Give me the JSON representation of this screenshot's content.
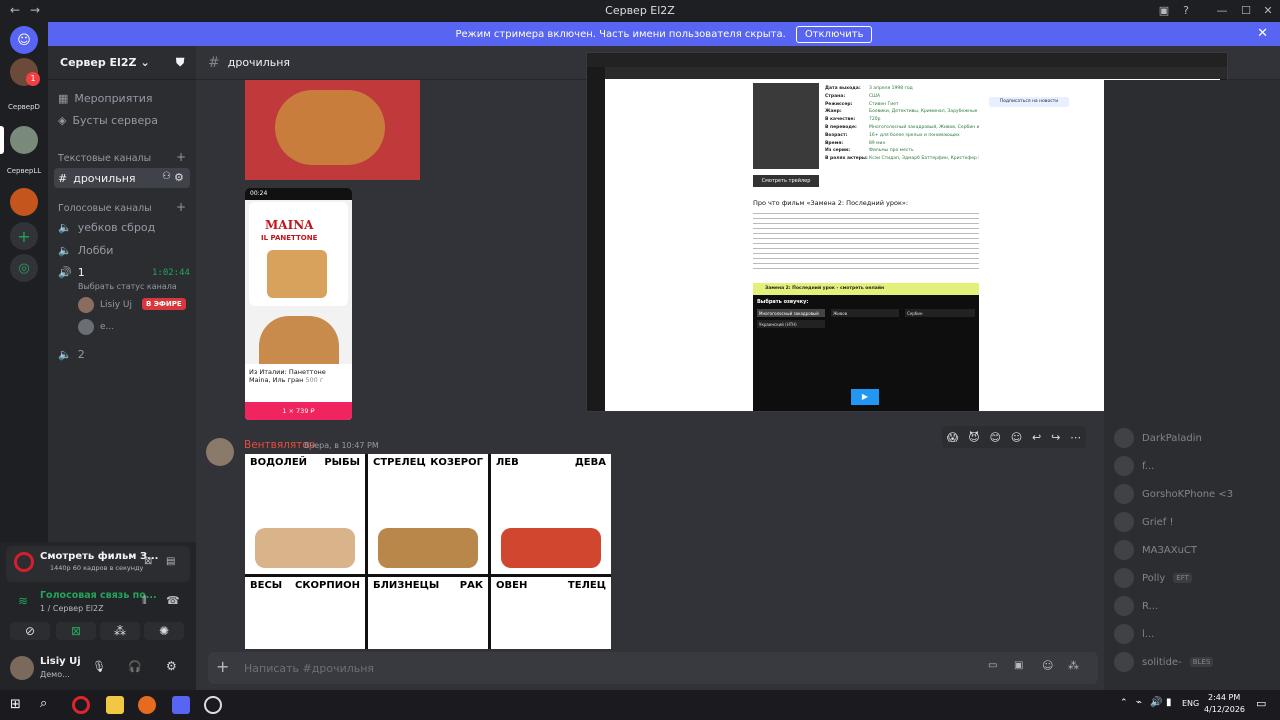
{
  "window": {
    "title": "Сервер El2Z"
  },
  "banner": {
    "text": "Режим стримера включен. Часть имени пользователя скрыта.",
    "button": "Отключить"
  },
  "servers": [
    {
      "label": "СерверD"
    },
    {
      "label": "СерверLL"
    }
  ],
  "badge": "1",
  "channel_sidebar": {
    "server_name": "Сервер El2Z",
    "events": "Мероприятия",
    "boosts": "Бусты сервера",
    "text_category": "Текстовые каналы",
    "text_channel": "дрочильня",
    "voice_category": "Голосовые каналы",
    "voice_channels": [
      {
        "name": "уебков сброд"
      },
      {
        "name": "Лобби"
      },
      {
        "name": "1",
        "timer": "1:02:44",
        "status": "Выбрать статус канала"
      },
      {
        "name": "2"
      }
    ],
    "voice_users": [
      {
        "name": "Lisiy Uj",
        "badge": "В ЭФИРЕ"
      },
      {
        "name": "е..."
      }
    ]
  },
  "stream_panel": {
    "title": "Смотреть фильм З...",
    "sub": "1440p 60 кадров в секунду"
  },
  "voice_panel": {
    "status": "Голосовая связь по...",
    "server": "1 / Сервер El2Z"
  },
  "user": {
    "name": "Lisiy Uj",
    "status": "Демо..."
  },
  "header": {
    "channel": "дрочильня"
  },
  "messages": {
    "product_title": "Из Италии: Панеттоне Maina, Иль гран",
    "product_weight": "500 г",
    "product_price": "1 × 739 ₽",
    "brand": "MAINA",
    "brand_sub": "IL PANETTONE",
    "phone_time": "00:24",
    "author": "Вентвялятор",
    "time": "Вчера, в 10:47 PM"
  },
  "horoscope": [
    {
      "a": "ВОДОЛЕЙ",
      "b": "РЫБЫ"
    },
    {
      "a": "СТРЕЛЕЦ",
      "b": "КОЗЕРОГ"
    },
    {
      "a": "ЛЕВ",
      "b": "ДЕВА"
    },
    {
      "a": "ВЕСЫ",
      "b": "СКОРПИОН"
    },
    {
      "a": "БЛИЗНЕЦЫ",
      "b": "РАК"
    },
    {
      "a": "ОВЕН",
      "b": "ТЕЛЕЦ"
    }
  ],
  "stream": {
    "section_title": "Про что фильм «Замена 2: Последний урок»:",
    "player_title": "Замена 2: Последний урок - смотреть онлайн",
    "choose_voice": "Выбрать озвучку:",
    "voices": [
      "Многоголосный закадровый",
      "Живов",
      "Сербин",
      "Украинский (НТН)"
    ],
    "subscribe": "Подписаться на новости",
    "trailer": "Смотреть трейлер",
    "info_labels": [
      "Дата выхода:",
      "Страна:",
      "Режиссер:",
      "Жанр:",
      "В качестве:",
      "В переводе:",
      "Возраст:",
      "Время:",
      "Из серии:",
      "В ролях актеры:"
    ],
    "info_values": [
      "3 апреля 1998 год",
      "США",
      "Стивен Гиет",
      "Боевики, Детективы, Криминал, Зарубежные",
      "720p",
      "Многоголосный закадровый, Живов, Сербин и Украинский (НТН)",
      "16+ для более зрелых и понимающих",
      "89 мин",
      "Фильмы про месть",
      "Ксэи Стидап, Эдмарб Баттерфин, Кристофер Кейжк..."
    ]
  },
  "members": [
    "DarkPaladin",
    "f...",
    "GorshoKPhone <3",
    "Grief !",
    "МАЗАХuCT",
    "Polly",
    "R...",
    "l...",
    "solitide-"
  ],
  "member_tags": {
    "polly": "EFT",
    "solitide": "BLES"
  },
  "composer": {
    "placeholder": "Написать #дрочильня"
  },
  "taskbar": {
    "lang": "ENG",
    "time": "2:44 PM",
    "date": "4/12/2026"
  }
}
